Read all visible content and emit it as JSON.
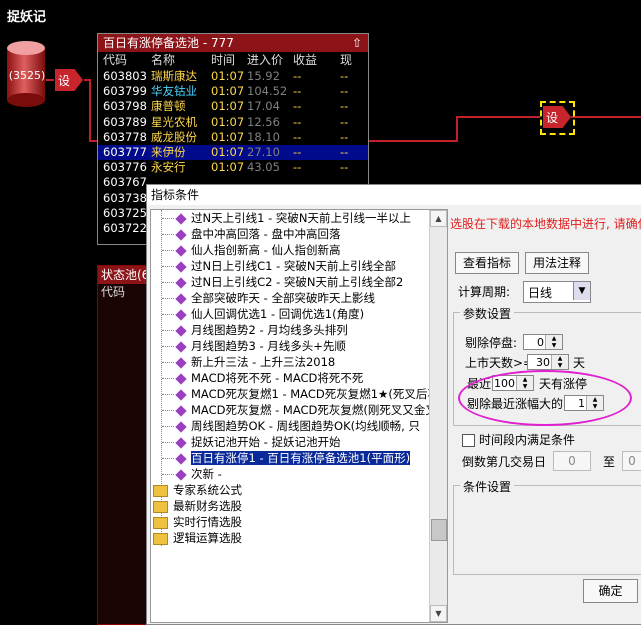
{
  "app_title": "捉妖记",
  "db_node": {
    "label": "(3525)"
  },
  "set_node_label": "设",
  "pool": {
    "title": "百日有涨停备选池 - 777",
    "pin_icon": "⇧",
    "columns": [
      "代码",
      "名称",
      "时间",
      "进入价",
      "收益",
      "现"
    ],
    "rows": [
      {
        "code": "603803",
        "name": "瑞斯康达",
        "time": "01:07",
        "price": "15.92",
        "gain": "--",
        "now": "--"
      },
      {
        "code": "603799",
        "name": "华友钴业",
        "time": "01:07",
        "price": "104.52",
        "gain": "--",
        "now": "--"
      },
      {
        "code": "603798",
        "name": "康普顿",
        "time": "01:07",
        "price": "17.04",
        "gain": "--",
        "now": "--"
      },
      {
        "code": "603789",
        "name": "星光农机",
        "time": "01:07",
        "price": "12.56",
        "gain": "--",
        "now": "--"
      },
      {
        "code": "603778",
        "name": "威龙股份",
        "time": "01:07",
        "price": "18.10",
        "gain": "--",
        "now": "--"
      },
      {
        "code": "603777",
        "name": "来伊份",
        "time": "01:07",
        "price": "27.10",
        "gain": "--",
        "now": "--"
      },
      {
        "code": "603776",
        "name": "永安行",
        "time": "01:07",
        "price": "43.05",
        "gain": "--",
        "now": "--"
      },
      {
        "code": "603767",
        "name": "",
        "time": "",
        "price": "",
        "gain": "",
        "now": ""
      },
      {
        "code": "603738",
        "name": "",
        "time": "",
        "price": "",
        "gain": "",
        "now": ""
      },
      {
        "code": "603725",
        "name": "",
        "time": "",
        "price": "",
        "gain": "",
        "now": ""
      },
      {
        "code": "603722",
        "name": "",
        "time": "",
        "price": "",
        "gain": "",
        "now": ""
      }
    ]
  },
  "status_pool": {
    "title": "状态池(6",
    "col": "代码"
  },
  "dialog": {
    "title": "指标条件",
    "hint": "选股在下载的本地数据中进行, 请确保",
    "tree_items": [
      {
        "text": "过N天上引线1 - 突破N天前上引线一半以上",
        "type": "formula"
      },
      {
        "text": "盘中冲高回落 - 盘中冲高回落",
        "type": "formula"
      },
      {
        "text": "仙人指创新高 - 仙人指创新高",
        "type": "formula"
      },
      {
        "text": "过N日上引线C1 - 突破N天前上引线全部",
        "type": "formula"
      },
      {
        "text": "过N日上引线C2 - 突破N天前上引线全部2",
        "type": "formula"
      },
      {
        "text": "全部突破昨天 - 全部突破昨天上影线",
        "type": "formula"
      },
      {
        "text": "仙人回调优选1 - 回调优选1(角度)",
        "type": "formula"
      },
      {
        "text": "月线图趋势2 - 月均线多头排列",
        "type": "formula"
      },
      {
        "text": "月线图趋势3 - 月线多头+先顺",
        "type": "formula"
      },
      {
        "text": "新上升三法 - 上升三法2018",
        "type": "formula"
      },
      {
        "text": "MACD将死不死 - MACD将死不死",
        "type": "formula"
      },
      {
        "text": "MACD死灰复燃1 - MACD死灰复燃1★(死叉后再",
        "type": "formula"
      },
      {
        "text": "MACD死灰复燃 - MACD死灰复燃(刚死叉又金叉",
        "type": "formula"
      },
      {
        "text": "周线图趋势OK - 周线图趋势OK(均线顺畅, 只",
        "type": "formula"
      },
      {
        "text": "捉妖记池开始 - 捉妖记池开始",
        "type": "formula"
      },
      {
        "text": "百日有涨停1 - 百日有涨停备选池1(平面形)",
        "type": "formula",
        "selected": true
      },
      {
        "text": "次新 -",
        "type": "formula"
      },
      {
        "text": "专家系统公式",
        "type": "folder"
      },
      {
        "text": "最新财务选股",
        "type": "folder"
      },
      {
        "text": "实时行情选股",
        "type": "folder"
      },
      {
        "text": "逻辑运算选股",
        "type": "folder"
      }
    ],
    "btn_view": "查看指标",
    "btn_usage": "用法注释",
    "period_label": "计算周期:",
    "period_value": "日线",
    "params_title": "参数设置",
    "p1_label": "剔除停盘:",
    "p1_value": "0",
    "p2_label": "上市天数>=",
    "p2_value": "30",
    "p2_unit": "天",
    "p3_label": "最近",
    "p3_value": "100",
    "p3_unit": "天有涨停",
    "p4_label": "剔除最近涨幅大的",
    "p4_value": "1",
    "period_check_label": "时间段内满足条件",
    "day_label": "倒数第几交易日",
    "day_from": "0",
    "day_to_label": "至",
    "day_to": "0",
    "cond_title": "条件设置",
    "ok_label": "确定"
  }
}
